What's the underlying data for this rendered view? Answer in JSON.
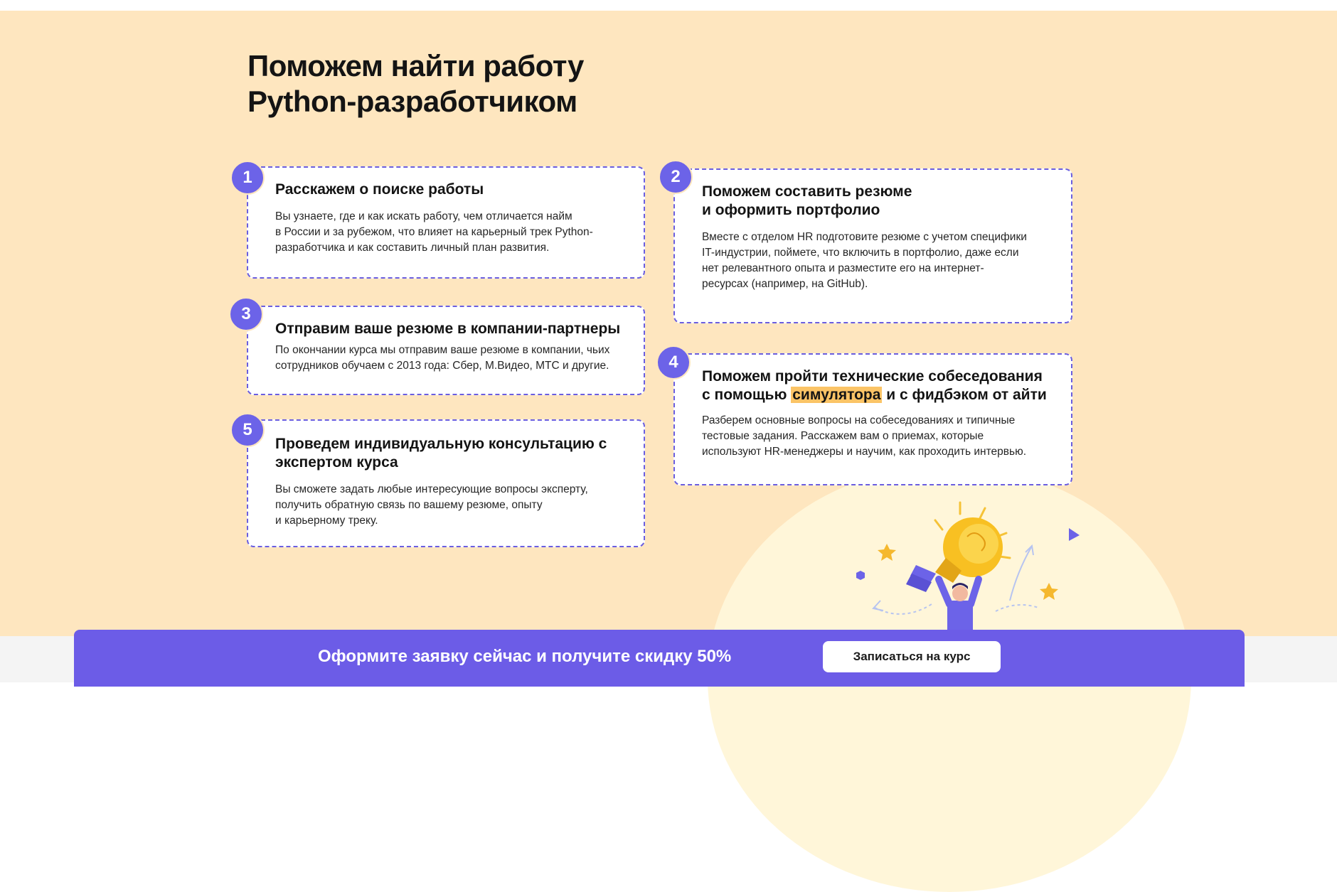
{
  "section": {
    "title_line1": "Поможем найти работу",
    "title_line2": "Python-разработчиком"
  },
  "steps": [
    {
      "number": "1",
      "title_lines": [
        "Расскажем о поиске работы"
      ],
      "text_lines": [
        "Вы узнаете, где и как искать работу, чем отличается найм",
        "в России и за рубежом, что влияет на карьерный трек Python-",
        "разработчика и как составить личный план развития."
      ]
    },
    {
      "number": "2",
      "title_lines": [
        "Поможем составить резюме",
        "и оформить портфолио"
      ],
      "text_lines": [
        "Вместе с отделом HR подготовите резюме с учетом специфики",
        "IT-индустрии, поймете, что включить в портфолио, даже если",
        "нет релевантного опыта и разместите его на интернет-",
        "ресурсах (например, на GitHub)."
      ]
    },
    {
      "number": "3",
      "title_lines": [
        "Отправим ваше резюме в компании-партнеры"
      ],
      "text_lines": [
        "По окончании курса мы отправим ваше резюме в компании, чьих",
        "сотрудников обучаем с 2013 года: Сбер, М.Видео, МТС и другие."
      ]
    },
    {
      "number": "4",
      "title_line1": "Поможем пройти технические собеседования",
      "title_line2_before": "с помощью ",
      "title_line2_highlight": "симулятора",
      "title_line2_after": " и с фидбэком от айти",
      "text_lines": [
        "Разберем основные вопросы на собеседованиях и типичные",
        "тестовые задания. Расскажем вам о приемах, которые",
        "используют HR-менеджеры и научим, как проходить интервью."
      ]
    },
    {
      "number": "5",
      "title_lines": [
        "Проведем индивидуальную консультацию с",
        "экспертом курса"
      ],
      "text_lines": [
        "Вы сможете задать любые интересующие вопросы эксперту,",
        "получить обратную связь по вашему резюме, опыту",
        "и карьерному треку."
      ]
    }
  ],
  "cta": {
    "text": "Оформите заявку сейчас и получите скидку 50%",
    "button_label": "Записаться на курс"
  },
  "illustration": {
    "icons": [
      "lightbulb-icon",
      "person-icon",
      "star-icon",
      "star-icon",
      "triangle-icon",
      "hexagon-icon",
      "arrow-icon"
    ]
  },
  "colors": {
    "section_bg": "#fee6bf",
    "accent": "#6c63e8",
    "highlight": "#fbc466",
    "cta_bg": "#6c5ce7"
  }
}
